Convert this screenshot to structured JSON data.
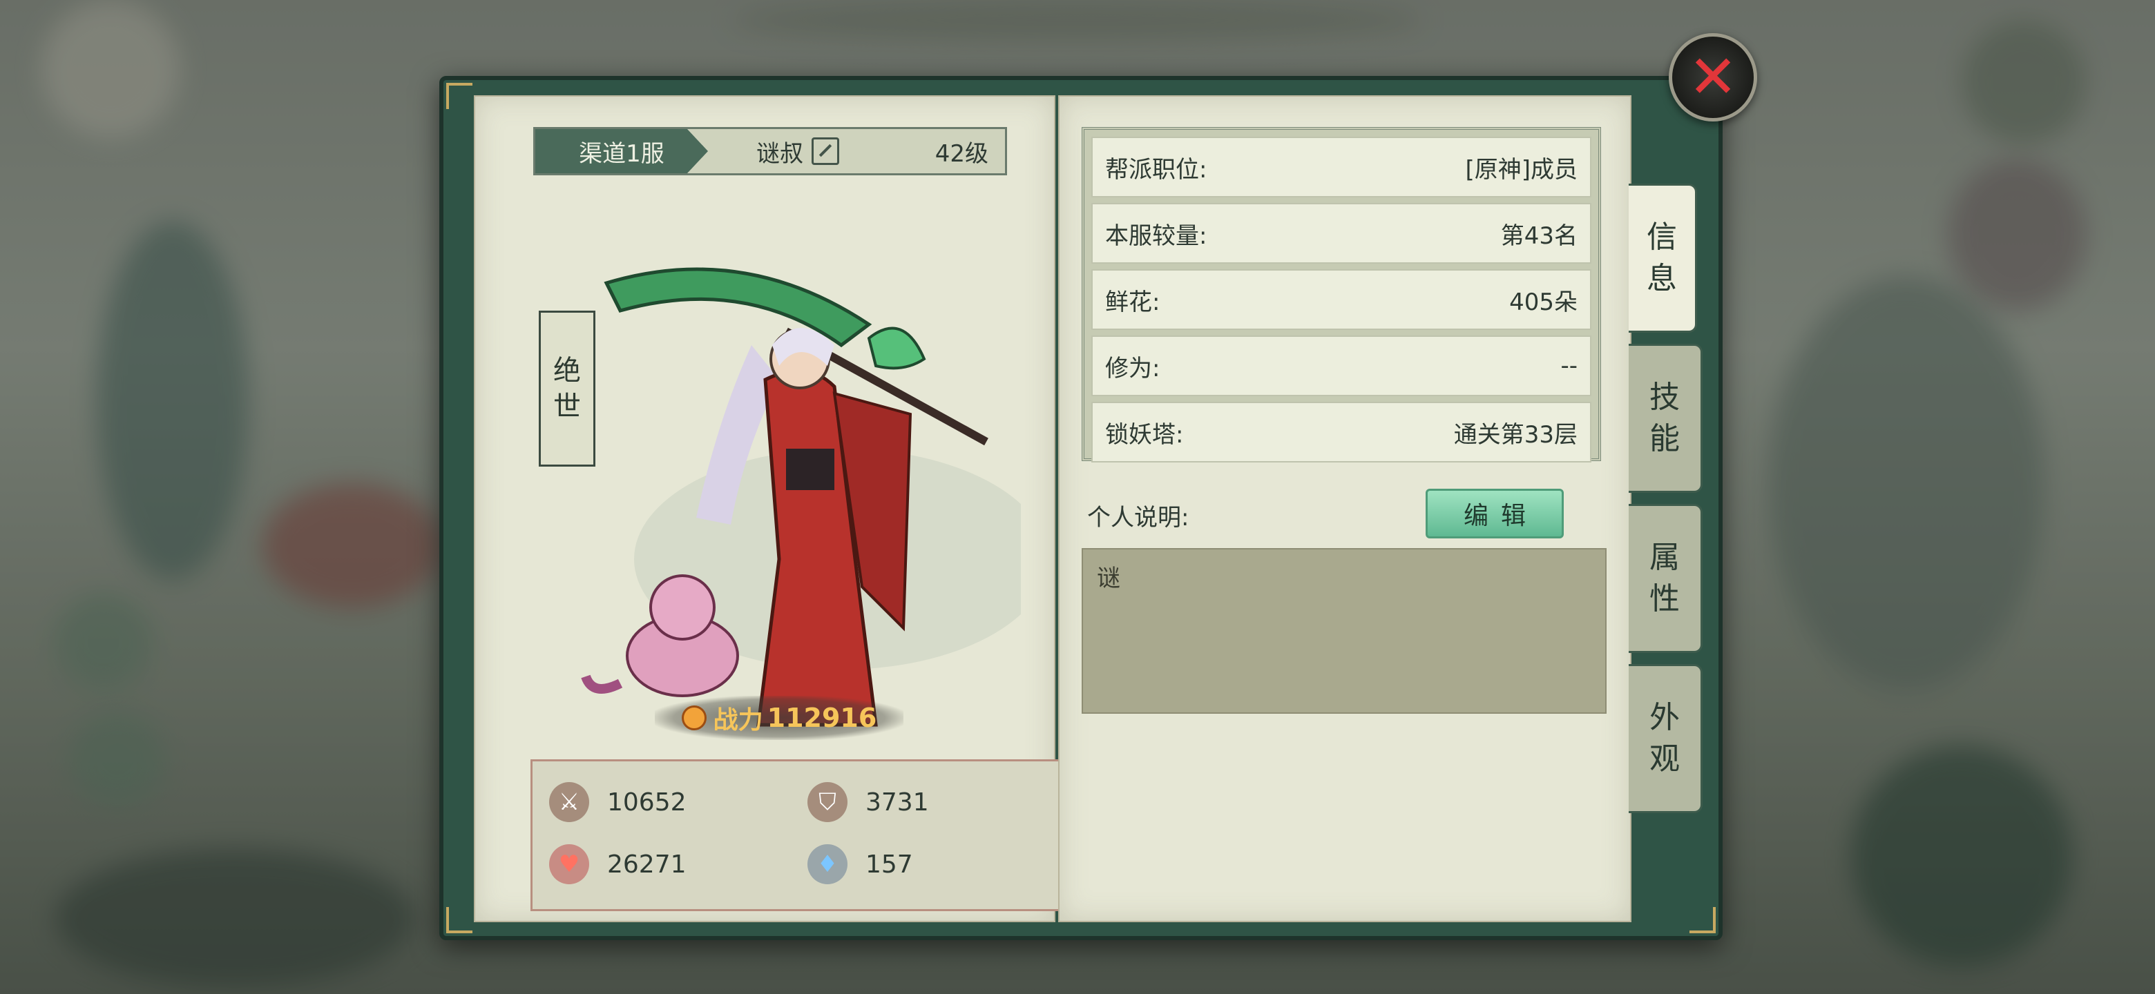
{
  "left_page": {
    "server": "渠道1服",
    "player_name": "谜叔",
    "level": "42级",
    "title_plate": [
      "绝",
      "世"
    ],
    "power_label": "战力",
    "power_value": "112916",
    "stats": [
      {
        "icon": "sword-icon",
        "value": "10652"
      },
      {
        "icon": "shield-icon",
        "value": "3731"
      },
      {
        "icon": "heart-icon",
        "value": "26271"
      },
      {
        "icon": "diamond-icon",
        "value": "157"
      }
    ]
  },
  "right_page": {
    "info": [
      {
        "label": "帮派职位:",
        "value": "[原神]成员"
      },
      {
        "label": "本服较量:",
        "value": "第43名"
      },
      {
        "label": "鲜花:",
        "value": "405朵"
      },
      {
        "label": "修为:",
        "value": "--"
      },
      {
        "label": "锁妖塔:",
        "value": "通关第33层"
      }
    ],
    "desc_label": "个人说明:",
    "edit_label": "编辑",
    "desc_text": "谜"
  },
  "tabs": [
    {
      "chars": [
        "信",
        "息"
      ],
      "active": true
    },
    {
      "chars": [
        "技",
        "能"
      ],
      "active": false
    },
    {
      "chars": [
        "属",
        "性"
      ],
      "active": false
    },
    {
      "chars": [
        "外",
        "观"
      ],
      "active": false
    }
  ],
  "close_icon": "close-icon",
  "colors": {
    "accent": "#4a6a5a",
    "close": "#e2363a",
    "power": "#f6c55a",
    "button": "#7fd0aa"
  }
}
